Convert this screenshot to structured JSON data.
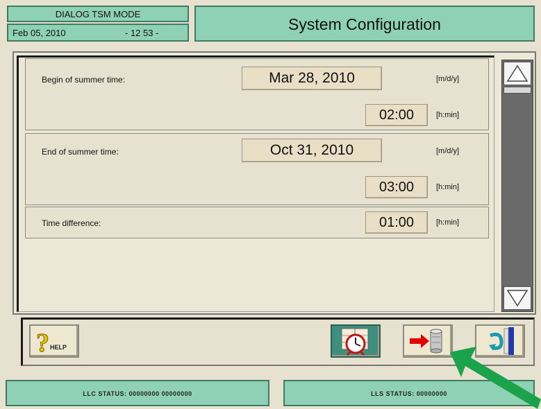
{
  "header": {
    "mode": "DIALOG TSM MODE",
    "date": "Feb 05, 2010",
    "time": "- 12 53 -",
    "title": "System Configuration"
  },
  "fields": {
    "begin_label": "Begin of summer time:",
    "begin_date": "Mar 28, 2010",
    "begin_date_unit": "[m/d/y]",
    "begin_time": "02:00",
    "begin_time_unit": "[h:min]",
    "end_label": "End of summer time:",
    "end_date": "Oct 31, 2010",
    "end_date_unit": "[m/d/y]",
    "end_time": "03:00",
    "end_time_unit": "[h:min]",
    "diff_label": "Time difference:",
    "diff_time": "01:00",
    "diff_time_unit": "[h:min]"
  },
  "toolbar": {
    "help_label": "HELP"
  },
  "status": {
    "llc": "LLC STATUS:  00000000  00000000",
    "lls": "LLS STATUS:  00000000"
  },
  "icons": {
    "help": "question-mark-icon",
    "clock": "calendar-clock-icon",
    "save": "arrow-to-disk-icon",
    "exit": "exit-door-icon",
    "scroll_up": "triangle-up-icon",
    "scroll_down": "triangle-down-icon",
    "annotation": "green-arrow-icon"
  },
  "colors": {
    "panel_teal": "#8fd1b5",
    "background": "#e6e2cf",
    "field": "#e9dfc6",
    "annotation_arrow": "#1aa34a"
  }
}
